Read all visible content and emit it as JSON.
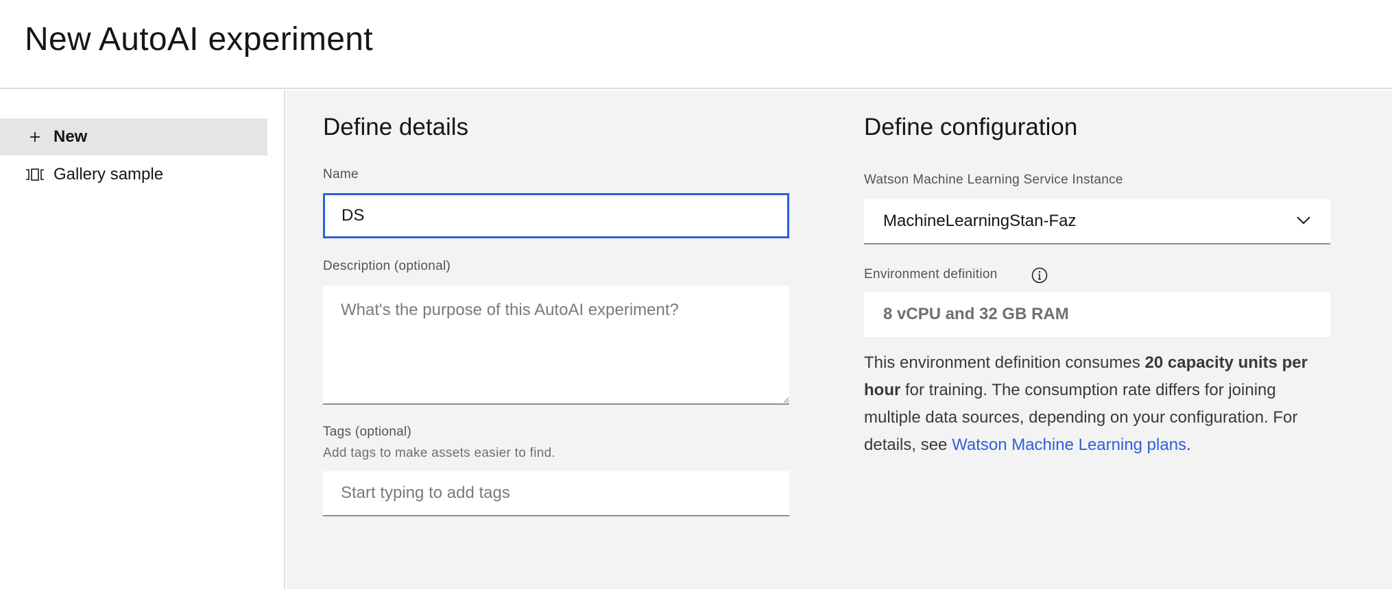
{
  "header": {
    "title": "New AutoAI experiment"
  },
  "sidebar": {
    "items": [
      {
        "label": "New",
        "icon": "plus-icon",
        "active": true
      },
      {
        "label": "Gallery sample",
        "icon": "gallery-icon",
        "active": false
      }
    ]
  },
  "details": {
    "heading": "Define details",
    "name_label": "Name",
    "name_value": "DS",
    "description_label": "Description (optional)",
    "description_placeholder": "What's the purpose of this AutoAI experiment?",
    "tags_label": "Tags (optional)",
    "tags_helper": "Add tags to make assets easier to find.",
    "tags_placeholder": "Start typing to add tags"
  },
  "configuration": {
    "heading": "Define configuration",
    "service_label": "Watson Machine Learning Service Instance",
    "service_value": "MachineLearningStan-Faz",
    "environment_label": "Environment definition",
    "environment_value": "8 vCPU and 32 GB RAM",
    "info_prefix": "This environment definition consumes ",
    "info_bold": "20 capacity units per hour",
    "info_middle": " for training. The consumption rate differs for joining multiple data sources, depending on your configuration. For details, see ",
    "info_link": "Watson Machine Learning plans",
    "info_suffix": "."
  },
  "colors": {
    "accent": "#2f5ed8",
    "panel_background": "#f3f3f3",
    "active_item": "#e5e5e5"
  }
}
